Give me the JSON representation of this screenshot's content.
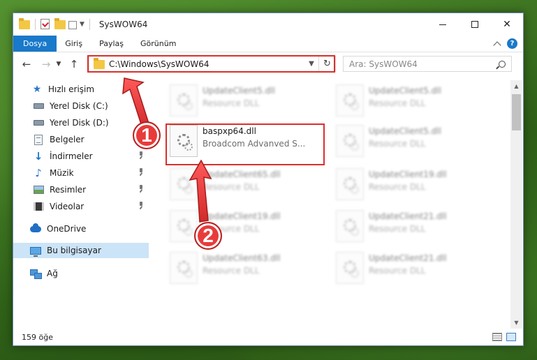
{
  "window": {
    "title": "SysWOW64",
    "controls": {
      "minimize": "minimize",
      "maximize": "maximize",
      "close": "✕"
    }
  },
  "ribbon": {
    "tabs": [
      "Dosya",
      "Giriş",
      "Paylaş",
      "Görünüm"
    ],
    "help": "?"
  },
  "navbar": {
    "address": "C:\\Windows\\SysWOW64",
    "search_placeholder": "Ara: SysWOW64"
  },
  "sidebar": {
    "items": [
      {
        "label": "Hızlı erişim",
        "icon": "star-icon"
      },
      {
        "label": "Yerel Disk (C:)",
        "icon": "drive-icon",
        "pinned": true
      },
      {
        "label": "Yerel Disk (D:)",
        "icon": "drive-icon",
        "pinned": true
      },
      {
        "label": "Belgeler",
        "icon": "documents-icon",
        "pinned": true
      },
      {
        "label": "İndirmeler",
        "icon": "download-icon",
        "pinned": true
      },
      {
        "label": "Müzik",
        "icon": "music-icon",
        "pinned": true
      },
      {
        "label": "Resimler",
        "icon": "pictures-icon",
        "pinned": true
      },
      {
        "label": "Videolar",
        "icon": "videos-icon",
        "pinned": true
      },
      {
        "label": "OneDrive",
        "icon": "onedrive-icon"
      },
      {
        "label": "Bu bilgisayar",
        "icon": "computer-icon",
        "selected": true
      },
      {
        "label": "Ağ",
        "icon": "network-icon"
      }
    ]
  },
  "files": {
    "items": [
      {
        "name": "UpdateClient5.dll",
        "desc": "Resource DLL"
      },
      {
        "name": "UpdateClient5.dll",
        "desc": "Resource DLL"
      },
      {
        "name": "baspxp64.dll",
        "desc": "Broadcom Advanved S...",
        "highlighted": true
      },
      {
        "name": "UpdateClient5.dll",
        "desc": "Resource DLL"
      },
      {
        "name": "UpdateClient65.dll",
        "desc": "Resource DLL"
      },
      {
        "name": "UpdateClient19.dll",
        "desc": "Resource DLL"
      },
      {
        "name": "UpdateClient19.dll",
        "desc": "Resource DLL"
      },
      {
        "name": "UpdateClient21.dll",
        "desc": "Resource DLL"
      },
      {
        "name": "UpdateClient63.dll",
        "desc": "Resource DLL"
      },
      {
        "name": "UpdateClient21.dll",
        "desc": "Resource DLL"
      }
    ]
  },
  "status": {
    "count": "159 öğe"
  },
  "annotations": {
    "marker1": "1",
    "marker2": "2",
    "color": "#e83b3b"
  },
  "colors": {
    "accent": "#1979ca",
    "highlight": "#d9302c",
    "selected": "#cce4f7"
  }
}
